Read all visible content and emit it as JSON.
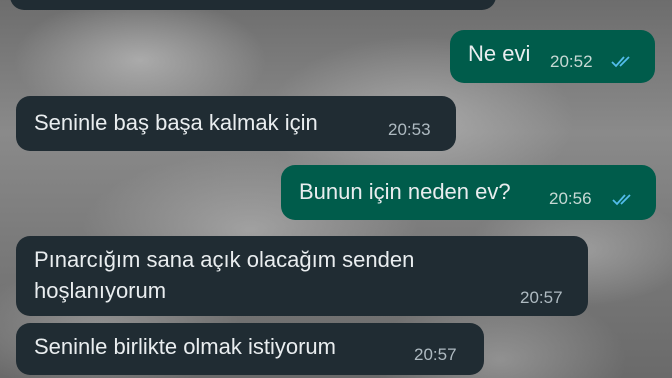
{
  "messages": [
    {
      "text": "Ne evi",
      "time": "20:52",
      "direction": "outgoing",
      "status": "read"
    },
    {
      "text": "Seninle baş başa kalmak için",
      "time": "20:53",
      "direction": "incoming"
    },
    {
      "text": "Bunun için neden ev?",
      "time": "20:56",
      "direction": "outgoing",
      "status": "read"
    },
    {
      "text_line1": "Pınarcığım sana açık olacağım senden",
      "text_line2": "hoşlanıyorum",
      "time": "20:57",
      "direction": "incoming"
    },
    {
      "text": "Seninle birlikte olmak istiyorum",
      "time": "20:57",
      "direction": "incoming"
    }
  ],
  "colors": {
    "incoming": "#202c33",
    "outgoing": "#005c4b",
    "read_ticks": "#53bdeb"
  }
}
